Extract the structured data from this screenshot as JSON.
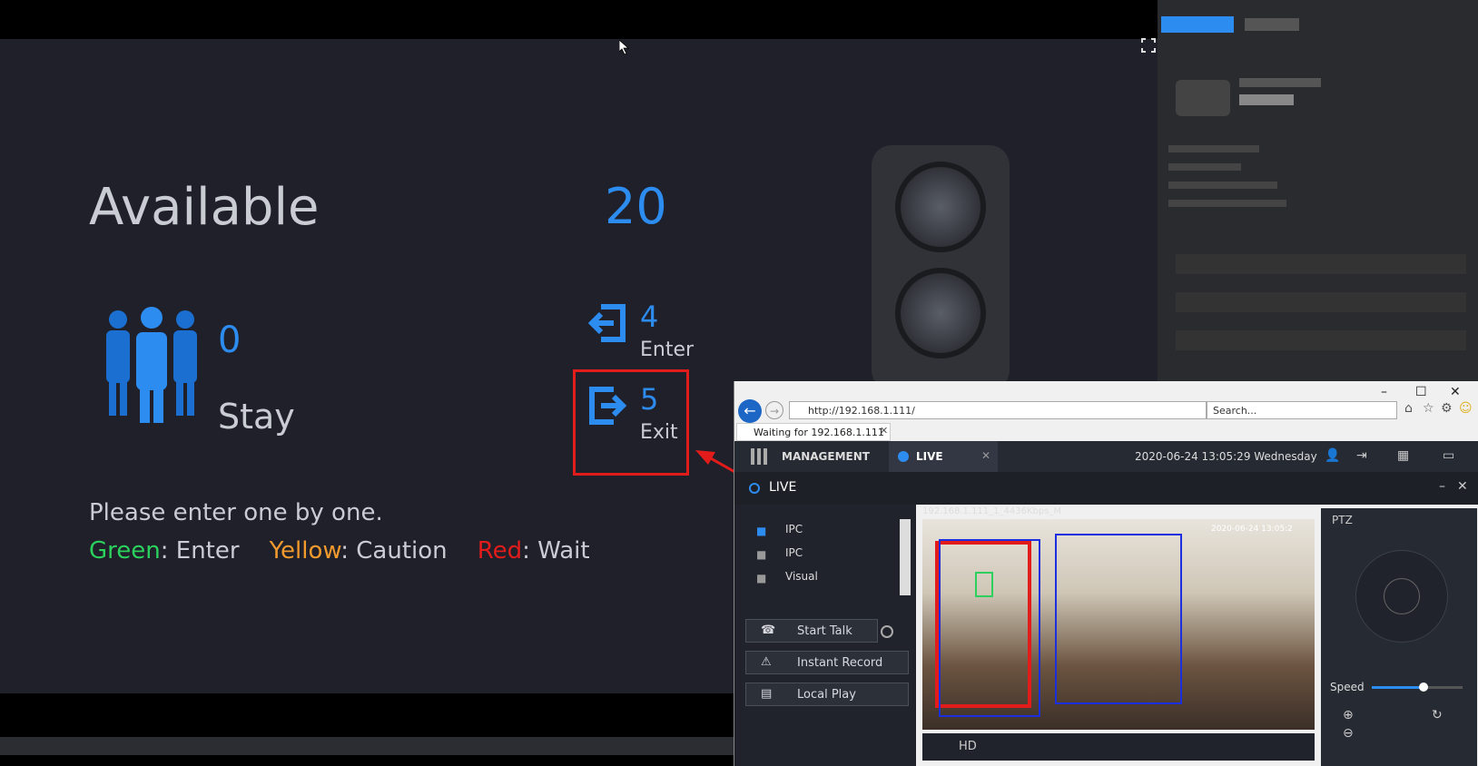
{
  "counter": {
    "available_label": "Available",
    "available_value": "20",
    "stay_value": "0",
    "stay_label": "Stay",
    "enter_value": "4",
    "enter_label": "Enter",
    "exit_value": "5",
    "exit_label": "Exit",
    "note": "Please enter one by one.",
    "legend": {
      "green": "Green",
      "green_text": ": Enter",
      "yellow": "Yellow",
      "yellow_text": ": Caution",
      "red": "Red",
      "red_text": ": Wait"
    }
  },
  "colors": {
    "accent_blue": "#2d8cf0",
    "green": "#2bd15c",
    "yellow": "#f29a2e",
    "red": "#e21b1b"
  },
  "browser": {
    "url": "http://192.168.1.111/",
    "search_placeholder": "Search...",
    "tab_title": "Waiting for 192.168.1.111",
    "app_tabs": [
      "MANAGEMENT",
      "LIVE"
    ],
    "datetime": "2020-06-24 13:05:29 Wednesday",
    "live_title": "LIVE",
    "device_list": [
      "IPC",
      "IPC",
      "Visual"
    ],
    "buttons": {
      "start_talk": "Start Talk",
      "instant_record": "Instant Record",
      "local_play": "Local Play"
    },
    "video_title": "192.168.1.111_1_4436Kbps_M",
    "video_timestamp": "2020-06-24 13:05:2",
    "ptz_title": "PTZ",
    "speed_label": "Speed",
    "hd_label": "HD"
  }
}
